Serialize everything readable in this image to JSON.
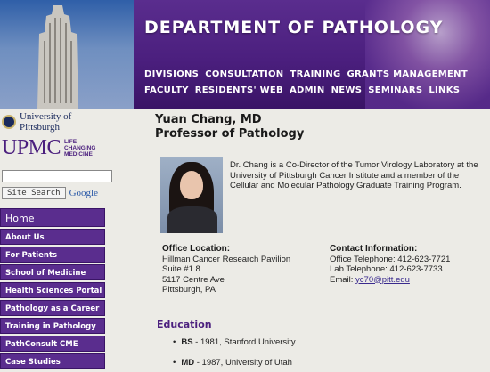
{
  "header": {
    "title": "DEPARTMENT OF PATHOLOGY",
    "nav_row1": [
      "DIVISIONS",
      "CONSULTATION",
      "TRAINING",
      "GRANTS MANAGEMENT"
    ],
    "nav_row2": [
      "FACULTY",
      "RESIDENTS' WEB",
      "ADMIN",
      "NEWS",
      "SEMINARS",
      "LINKS"
    ]
  },
  "sidebar": {
    "pitt_label": "University of Pittsburgh",
    "upmc_logo": "UPMC",
    "upmc_tagline": "LIFE CHANGING MEDICINE",
    "search_placeholder": "",
    "search_button": "Site Search",
    "google_label": "Google",
    "menu": [
      "Home",
      "About Us",
      "For Patients",
      "School of Medicine",
      "Health Sciences Portal",
      "Pathology as a Career",
      "Training in Pathology",
      "PathConsult CME",
      "Case Studies"
    ]
  },
  "profile": {
    "name": "Yuan Chang, MD",
    "title": "Professor of Pathology",
    "bio": "Dr. Chang is a Co-Director of the Tumor Virology Laboratory at the University of Pittsburgh Cancer Institute and a member of the Cellular and Molecular Pathology Graduate Training Program.",
    "office": {
      "label": "Office Location:",
      "line1": "Hillman Cancer Research Pavilion",
      "line2": "Suite #1.8",
      "line3": "5117 Centre Ave",
      "line4": "Pittsburgh, PA"
    },
    "contact": {
      "label": "Contact Information:",
      "office_tel": "Office Telephone: 412-623-7721",
      "lab_tel": "Lab Telephone: 412-623-7733",
      "email_label": "Email: ",
      "email": "yc70@pitt.edu"
    },
    "education": {
      "heading": "Education",
      "items": [
        {
          "degree": "BS",
          "detail": " - 1981, Stanford University"
        },
        {
          "degree": "MD",
          "detail": " - 1987, University of Utah"
        }
      ]
    }
  },
  "colors": {
    "brand_purple": "#5a2d8e",
    "link": "#3a2a8e"
  }
}
